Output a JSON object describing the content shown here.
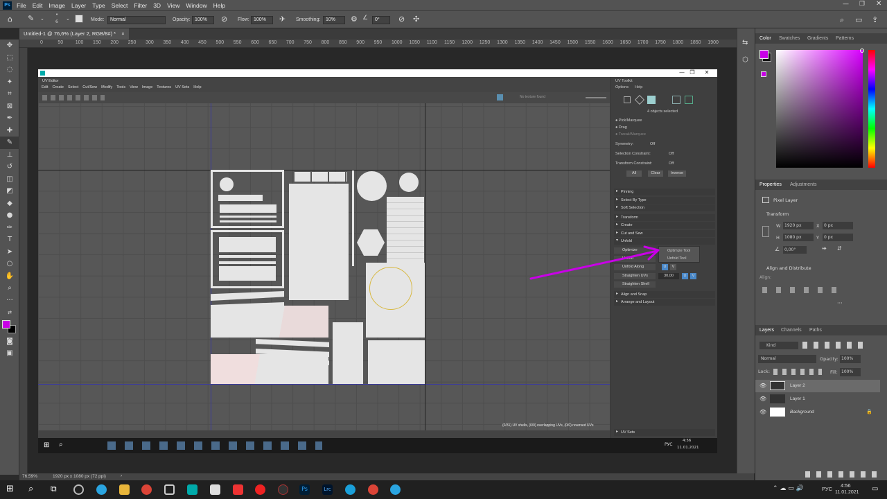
{
  "app": {
    "logo": "Ps",
    "menu": [
      "File",
      "Edit",
      "Image",
      "Layer",
      "Type",
      "Select",
      "Filter",
      "3D",
      "View",
      "Window",
      "Help"
    ]
  },
  "options": {
    "mode_label": "Mode:",
    "mode_value": "Normal",
    "opacity_label": "Opacity:",
    "opacity_value": "100%",
    "flow_label": "Flow:",
    "flow_value": "100%",
    "smoothing_label": "Smoothing:",
    "smoothing_value": "10%",
    "angle_value": "0°",
    "brush_size": "6"
  },
  "doc_tab": {
    "title": "Untitled-1 @ 76,6% (Layer 2, RGB/8#) *",
    "close": "×"
  },
  "ruler_ticks": [
    "0",
    "50",
    "100",
    "150",
    "200",
    "250",
    "300",
    "350",
    "400",
    "450",
    "500",
    "550",
    "600",
    "650",
    "700",
    "750",
    "800",
    "850",
    "900",
    "950",
    "1000",
    "1050",
    "1100",
    "1150",
    "1200",
    "1250",
    "1300",
    "1350",
    "1400",
    "1450",
    "1500",
    "1550",
    "1600",
    "1650",
    "1700",
    "1750",
    "1800",
    "1850",
    "1900"
  ],
  "maya": {
    "uv_editor_title": "UV Editor",
    "uv_menu": [
      "Edit",
      "Create",
      "Select",
      "Cut/Sew",
      "Modify",
      "Tools",
      "View",
      "Image",
      "Textures",
      "UV Sets",
      "Help"
    ],
    "no_texture": "No texture found",
    "status": "(0/31) UV shells, (0/0) overlapping UVs, (0/0) reversed UVs",
    "toolkit": {
      "title": "UV Toolkit",
      "menu": [
        "Options",
        "Help"
      ],
      "selected": "4 objects selected",
      "modes": [
        "Pick/Marquee",
        "Drag",
        "Tweak/Marquee"
      ],
      "symmetry_label": "Symmetry:",
      "symmetry_value": "Off",
      "sel_constraint_label": "Selection Constraint:",
      "sel_constraint_value": "Off",
      "trans_constraint_label": "Transform Constraint:",
      "trans_constraint_value": "Off",
      "buttons": [
        "All",
        "Clear",
        "Inverse"
      ],
      "sections": [
        "Pinning",
        "Select By Type",
        "Soft Selection",
        "Transform",
        "Create",
        "Cut and Sew",
        "Unfold"
      ],
      "unfold_items": [
        "Optimize",
        "Unfold",
        "Unfold Along",
        "Straighten UVs",
        "Straighten Shell"
      ],
      "popup": [
        "Optimize Tool",
        "Unfold Tool"
      ],
      "straighten_value": "30,00",
      "uv": [
        "U",
        "V"
      ],
      "more_sections": [
        "Align and Snap",
        "Arrange and Layout"
      ],
      "uv_sets": "UV Sets"
    },
    "inner_tray": {
      "lang": "РУС",
      "time": "4:56",
      "date": "11.01.2021"
    }
  },
  "panels": {
    "color_tabs": [
      "Color",
      "Swatches",
      "Gradients",
      "Patterns"
    ],
    "fg_color": "#c800e6",
    "props_tabs": [
      "Properties",
      "Adjustments"
    ],
    "layer_type": "Pixel Layer",
    "transform": "Transform",
    "w_label": "W",
    "w_value": "1920 px",
    "x_label": "X",
    "x_value": "0 px",
    "h_label": "H",
    "h_value": "1080 px",
    "y_label": "Y",
    "y_value": "0 px",
    "angle_value": "0,00°",
    "align": "Align and Distribute",
    "align_sub": "Align:",
    "layers_tabs": [
      "Layers",
      "Channels",
      "Paths"
    ],
    "kind": "Kind",
    "blend": "Normal",
    "opacity_label": "Opacity:",
    "opacity_value": "100%",
    "lock_label": "Lock:",
    "fill_label": "Fill:",
    "fill_value": "100%",
    "layers": [
      "Layer 2",
      "Layer 1",
      "Background"
    ]
  },
  "status": {
    "zoom": "76,59%",
    "size": "1920 px x 1080 px (72 ppi)"
  },
  "taskbar": {
    "lang": "РУС",
    "time": "4:56",
    "date": "11.01.2021"
  },
  "colors": {
    "accent": "#c800e6",
    "uv_blue": "#4a88c8"
  }
}
